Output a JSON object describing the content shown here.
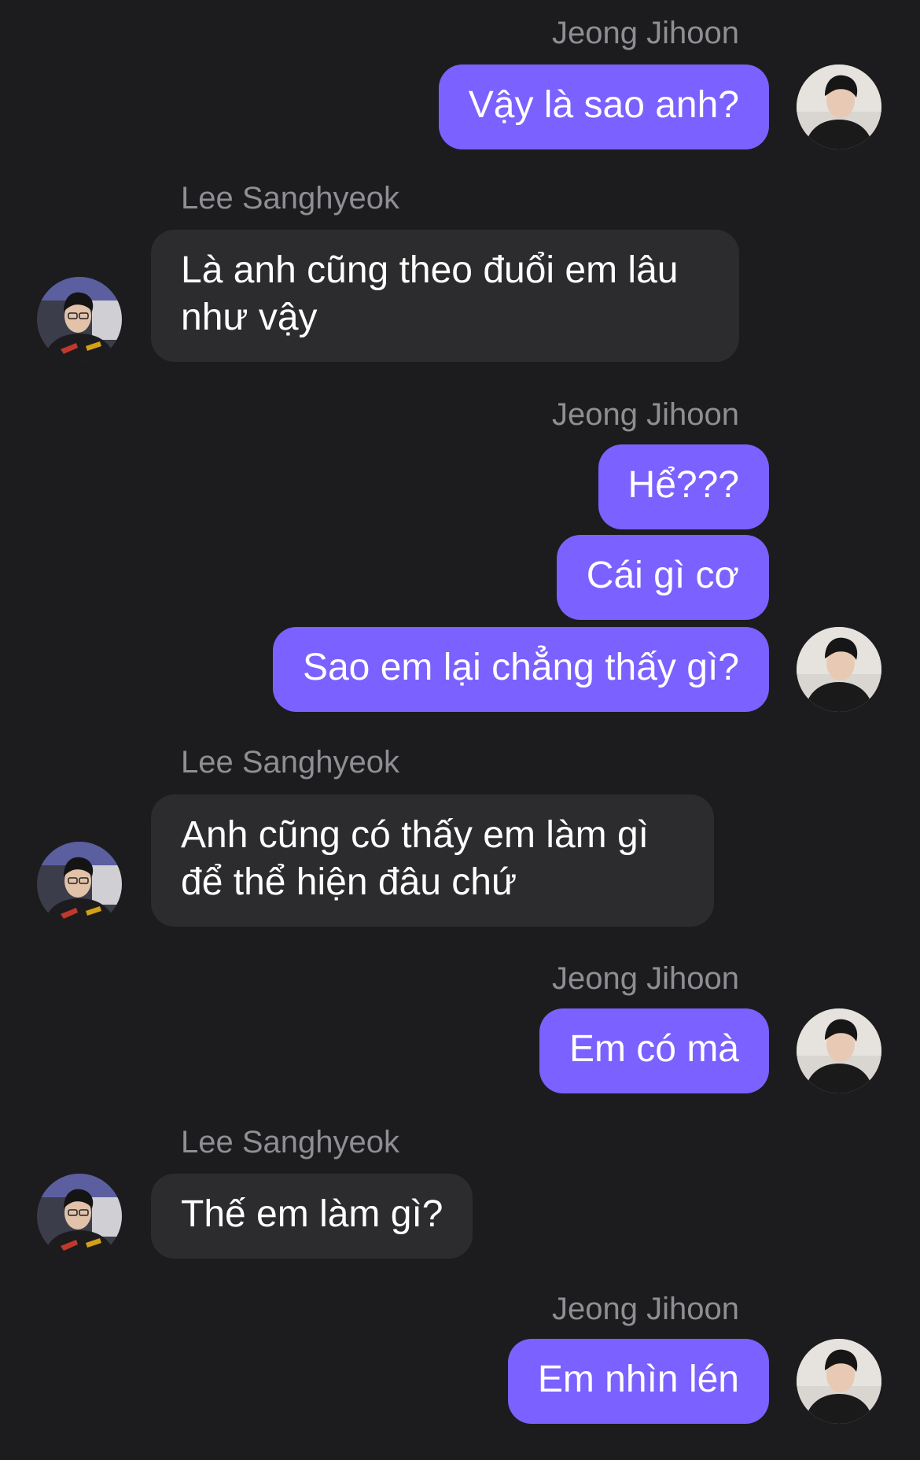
{
  "participants": {
    "me": "Jeong Jihoon",
    "other": "Lee Sanghyeok"
  },
  "colors": {
    "background": "#1c1c1e",
    "outgoing_bubble": "#7b61ff",
    "incoming_bubble": "#2c2c2e",
    "name_text": "#8e8e93"
  },
  "messages": [
    {
      "sender": "Jeong Jihoon",
      "text": "Vậy là sao anh?"
    },
    {
      "sender": "Lee Sanghyeok",
      "text": "Là anh cũng theo đuổi em lâu như vậy"
    },
    {
      "sender": "Jeong Jihoon",
      "text": "Hể???"
    },
    {
      "sender": "Jeong Jihoon",
      "text": "Cái gì cơ"
    },
    {
      "sender": "Jeong Jihoon",
      "text": "Sao em lại chẳng thấy gì?"
    },
    {
      "sender": "Lee Sanghyeok",
      "text": "Anh cũng có thấy em làm gì để thể hiện đâu chứ"
    },
    {
      "sender": "Jeong Jihoon",
      "text": "Em có mà"
    },
    {
      "sender": "Lee Sanghyeok",
      "text": "Thế em làm gì?"
    },
    {
      "sender": "Jeong Jihoon",
      "text": "Em nhìn lén"
    }
  ],
  "avatar_icons": {
    "me": "avatar-jeong-jihoon",
    "other": "avatar-lee-sanghyeok"
  }
}
